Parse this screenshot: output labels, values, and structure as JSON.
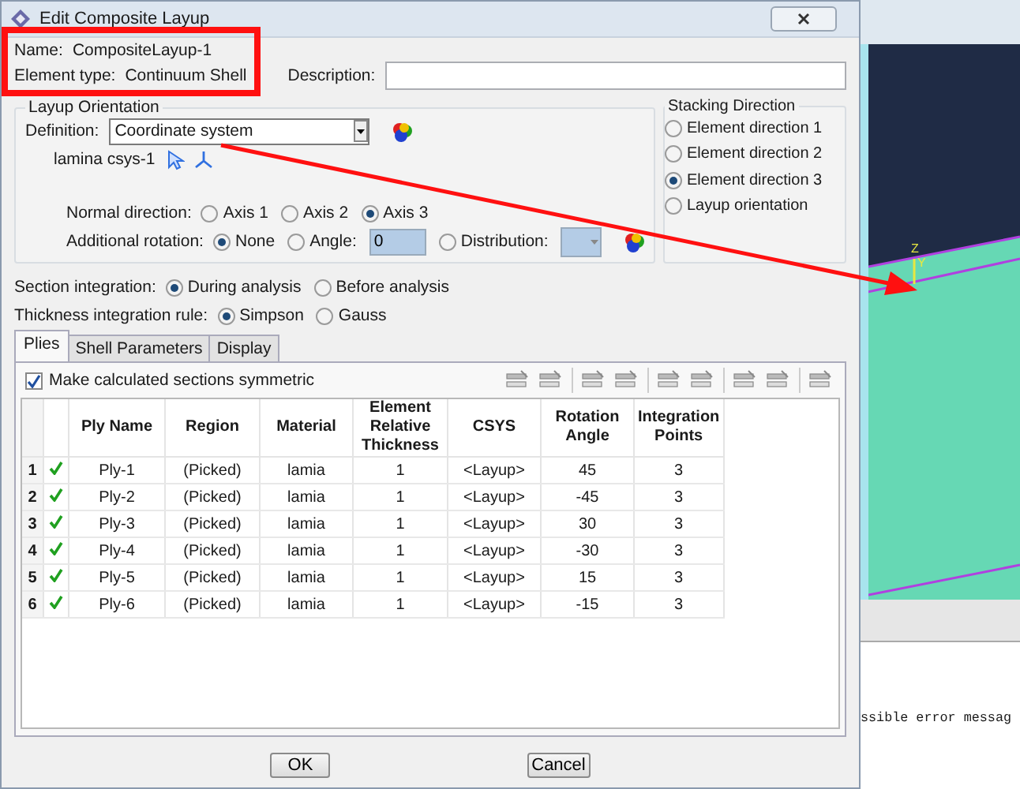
{
  "window": {
    "title": "Edit Composite Layup"
  },
  "name": {
    "label": "Name:",
    "value": "CompositeLayup-1"
  },
  "element_type": {
    "label": "Element type:",
    "value": "Continuum Shell"
  },
  "description": {
    "label": "Description:"
  },
  "layup_orientation": {
    "title": "Layup Orientation",
    "definition": {
      "label": "Definition:",
      "value": "Coordinate system"
    },
    "csys": "lamina csys-1",
    "normal_direction": {
      "label": "Normal direction:",
      "options": [
        {
          "label": "Axis 1",
          "selected": false
        },
        {
          "label": "Axis 2",
          "selected": false
        },
        {
          "label": "Axis 3",
          "selected": true
        }
      ]
    },
    "additional_rotation": {
      "label": "Additional rotation:",
      "options": [
        {
          "kind": "plain",
          "label": "None",
          "selected": true
        },
        {
          "kind": "field",
          "label": "Angle:",
          "value": "0",
          "selected": false
        },
        {
          "kind": "dropdown",
          "label": "Distribution:",
          "selected": false
        }
      ]
    }
  },
  "stacking_direction": {
    "title": "Stacking Direction",
    "options": [
      {
        "label": "Element direction 1",
        "selected": false
      },
      {
        "label": "Element direction 2",
        "selected": false
      },
      {
        "label": "Element direction 3",
        "selected": true
      },
      {
        "label": "Layup orientation",
        "selected": false
      }
    ]
  },
  "section_integration": {
    "label": "Section integration:",
    "options": [
      {
        "label": "During analysis",
        "selected": true
      },
      {
        "label": "Before analysis",
        "selected": false
      }
    ]
  },
  "thickness_rule": {
    "label": "Thickness integration rule:",
    "options": [
      {
        "label": "Simpson",
        "selected": true
      },
      {
        "label": "Gauss",
        "selected": false
      }
    ]
  },
  "tabs": [
    {
      "label": "Plies",
      "selected": true
    },
    {
      "label": "Shell Parameters",
      "selected": false
    },
    {
      "label": "Display",
      "selected": false
    }
  ],
  "symmetric": {
    "label": "Make calculated sections symmetric",
    "checked": true
  },
  "table": {
    "columns": [
      "Ply Name",
      "Region",
      "Material",
      "Element Relative Thickness",
      "CSYS",
      "Rotation Angle",
      "Integration Points"
    ],
    "rows": [
      {
        "number": "1",
        "valid": true,
        "cells": [
          "Ply-1",
          "(Picked)",
          "lamia",
          "1",
          "<Layup>",
          "45",
          "3"
        ]
      },
      {
        "number": "2",
        "valid": true,
        "cells": [
          "Ply-2",
          "(Picked)",
          "lamia",
          "1",
          "<Layup>",
          "-45",
          "3"
        ]
      },
      {
        "number": "3",
        "valid": true,
        "cells": [
          "Ply-3",
          "(Picked)",
          "lamia",
          "1",
          "<Layup>",
          "30",
          "3"
        ]
      },
      {
        "number": "4",
        "valid": true,
        "cells": [
          "Ply-4",
          "(Picked)",
          "lamia",
          "1",
          "<Layup>",
          "-30",
          "3"
        ]
      },
      {
        "number": "5",
        "valid": true,
        "cells": [
          "Ply-5",
          "(Picked)",
          "lamia",
          "1",
          "<Layup>",
          "15",
          "3"
        ]
      },
      {
        "number": "6",
        "valid": true,
        "cells": [
          "Ply-6",
          "(Picked)",
          "lamia",
          "1",
          "<Layup>",
          "-15",
          "3"
        ]
      }
    ]
  },
  "buttons": [
    "OK",
    "Cancel"
  ],
  "viewport": {
    "axis_labels": [
      "Z",
      "Y"
    ]
  },
  "message_area": {
    "text": "ssible error messag"
  }
}
